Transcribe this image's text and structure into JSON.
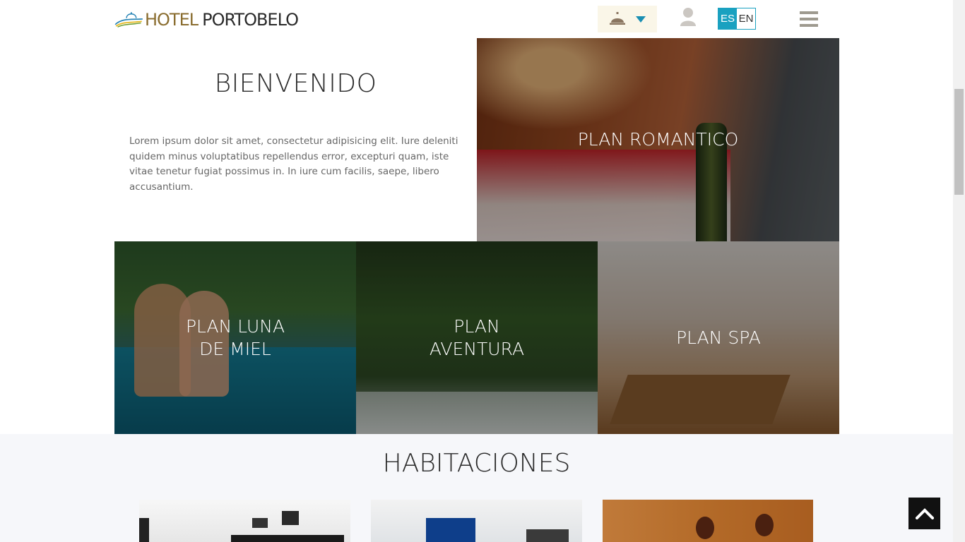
{
  "header": {
    "logo_word1": "HOTEL",
    "logo_word2": "PORTOBELO",
    "bell_icon": "reception-bell-icon",
    "dropdown_icon": "caret-down-icon",
    "user_icon": "user-icon",
    "menu_icon": "hamburger-menu-icon",
    "lang_es": "ES",
    "lang_en": "EN"
  },
  "welcome": {
    "title": "BIENVENIDO",
    "text": "Lorem ipsum dolor sit amet, consectetur adipisicing elit. Iure deleniti quidem minus voluptatibus repellendus error, excepturi quam, iste vitae tenetur fugiat possimus in. In iure cum facilis, saepe, libero accusantium."
  },
  "plans": {
    "romantico": "PLAN ROMANTICO",
    "luna_line1": "PLAN LUNA",
    "luna_line2": "DE MIEL",
    "aventura_line1": "PLAN",
    "aventura_line2": "AVENTURA",
    "spa": "PLAN SPA"
  },
  "habitaciones": {
    "title": "HABITACIONES"
  },
  "back_to_top_icon": "chevron-up-icon",
  "colors": {
    "accent": "#1aa1c0",
    "logo_gold": "#8a6d2f",
    "menu_gray": "#9e9a8f"
  }
}
